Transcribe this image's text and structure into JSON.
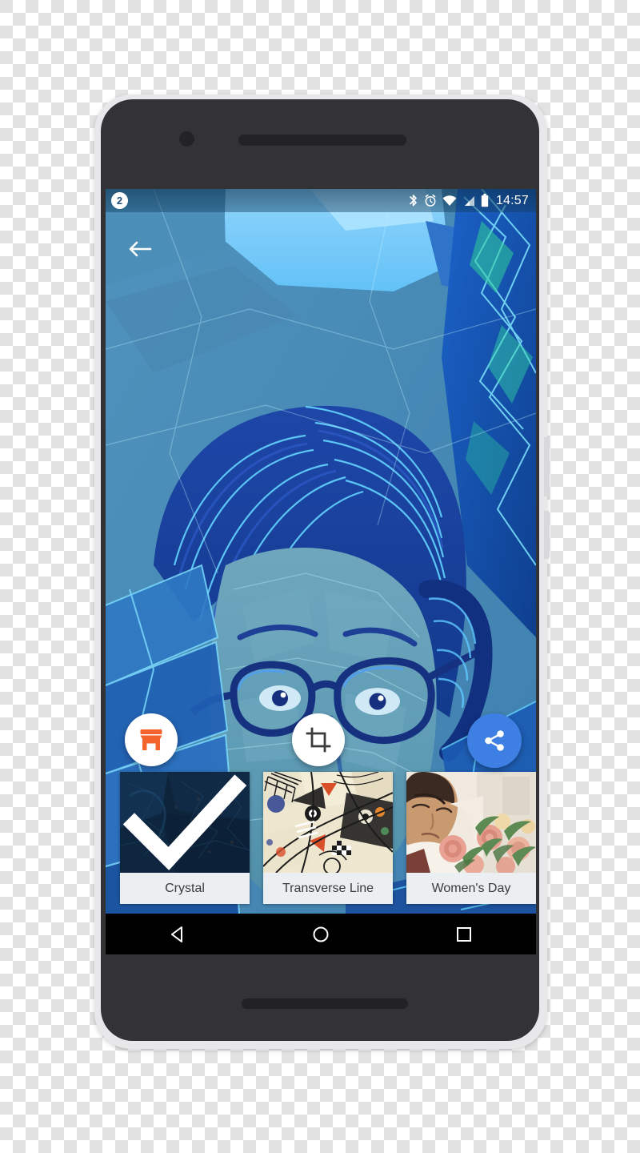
{
  "device": {
    "name": "android-phone-mockup",
    "front_camera": "front-camera",
    "earpiece": "earpiece-speaker",
    "bottom_speaker": "bottom-speaker",
    "power_button": "power-button",
    "volume_button": "volume-button"
  },
  "statusbar": {
    "app_badge": "2",
    "clock": "14:57",
    "icons": [
      "bluetooth-icon",
      "alarm-icon",
      "wifi-icon",
      "cellular-signal-icon",
      "battery-icon"
    ]
  },
  "app": {
    "back_label": "back-arrow",
    "photo_description": "crystal-style filtered portrait of a person wearing glasses"
  },
  "actions": {
    "store": {
      "name": "store-button",
      "icon": "store-icon",
      "color": "#f4632b"
    },
    "crop": {
      "name": "crop-button",
      "icon": "crop-icon",
      "color": "#3b3b3b"
    },
    "share": {
      "name": "share-button",
      "icon": "share-icon",
      "color": "#3d7fe3"
    }
  },
  "filters": {
    "selected_index": 0,
    "items": [
      {
        "label": "Crystal",
        "selected": true
      },
      {
        "label": "Transverse Line",
        "selected": false
      },
      {
        "label": "Women's Day",
        "selected": false
      }
    ]
  },
  "navbar": {
    "back": "nav-back-icon",
    "home": "nav-home-icon",
    "recents": "nav-recents-icon"
  },
  "colors": {
    "accent_blue": "#3d7fe3",
    "store_orange": "#f4632b",
    "device_body": "#333336",
    "device_rim": "#e8e8ea",
    "filter_card_bg": "#eceff1"
  }
}
